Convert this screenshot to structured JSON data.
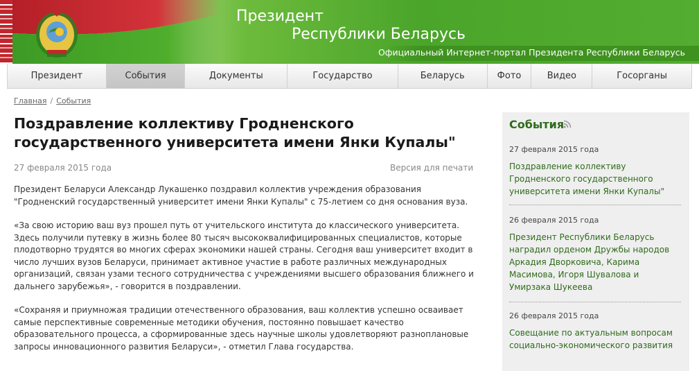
{
  "header": {
    "title_line1": "Президент",
    "title_line2": "Республики Беларусь",
    "subtitle": "Официальный Интернет-портал Президента Республики Беларусь"
  },
  "nav": {
    "items": [
      {
        "label": "Президент"
      },
      {
        "label": "События"
      },
      {
        "label": "Документы"
      },
      {
        "label": "Государство"
      },
      {
        "label": "Беларусь"
      },
      {
        "label": "Фото"
      },
      {
        "label": "Видео"
      },
      {
        "label": "Госорганы"
      }
    ],
    "active": "События"
  },
  "breadcrumb": {
    "home": "Главная",
    "separator": "/",
    "current": "События"
  },
  "article": {
    "title": "Поздравление коллективу Гродненского государственного университета имени Янки Купалы\"",
    "date": "27 февраля 2015 года",
    "print_label": "Версия для печати",
    "paragraphs": [
      "Президент Беларуси Александр Лукашенко поздравил коллектив учреждения образования \"Гродненский государственный университет имени Янки Купалы\" с 75-летием со дня основания вуза.",
      "«За свою историю ваш вуз прошел путь от учительского института до классического университета. Здесь получили путевку в жизнь более 80 тысяч высококвалифицированных специалистов, которые плодотворно трудятся во многих сферах экономики нашей страны. Сегодня ваш университет входит в число лучших вузов Беларуси, принимает активное участие в работе различных международных организаций, связан узами тесного сотрудничества с учреждениями высшего образования ближнего и дальнего зарубежья», - говорится в поздравлении.",
      "«Сохраняя и приумножая традиции отечественного образования, ваш коллектив успешно осваивает самые перспективные современные методики обучения, постоянно повышает качество образовательного процесса, а сформированные здесь научные школы удовлетворяют разноплановые запросы инновационного развития Беларуси», - отметил Глава государства."
    ]
  },
  "sidebar": {
    "title": "События",
    "rss_icon": "rss-icon",
    "items": [
      {
        "date": "27 февраля 2015 года",
        "link": "Поздравление коллективу Гродненского государственного университета имени Янки Купалы\""
      },
      {
        "date": "26 февраля 2015 года",
        "link": "Президент Республики Беларусь наградил орденом Дружбы народов Аркадия Дворковича, Карима Масимова, Игоря Шувалова и Умирзака Шукеева"
      },
      {
        "date": "26 февраля 2015 года",
        "link": "Совещание по актуальным вопросам социально-экономического развития"
      }
    ]
  },
  "colors": {
    "header_green": "#4aa52a",
    "flag_red": "#c3252c",
    "link_green": "#2f6b1c",
    "sidebar_bg": "#efefef"
  }
}
